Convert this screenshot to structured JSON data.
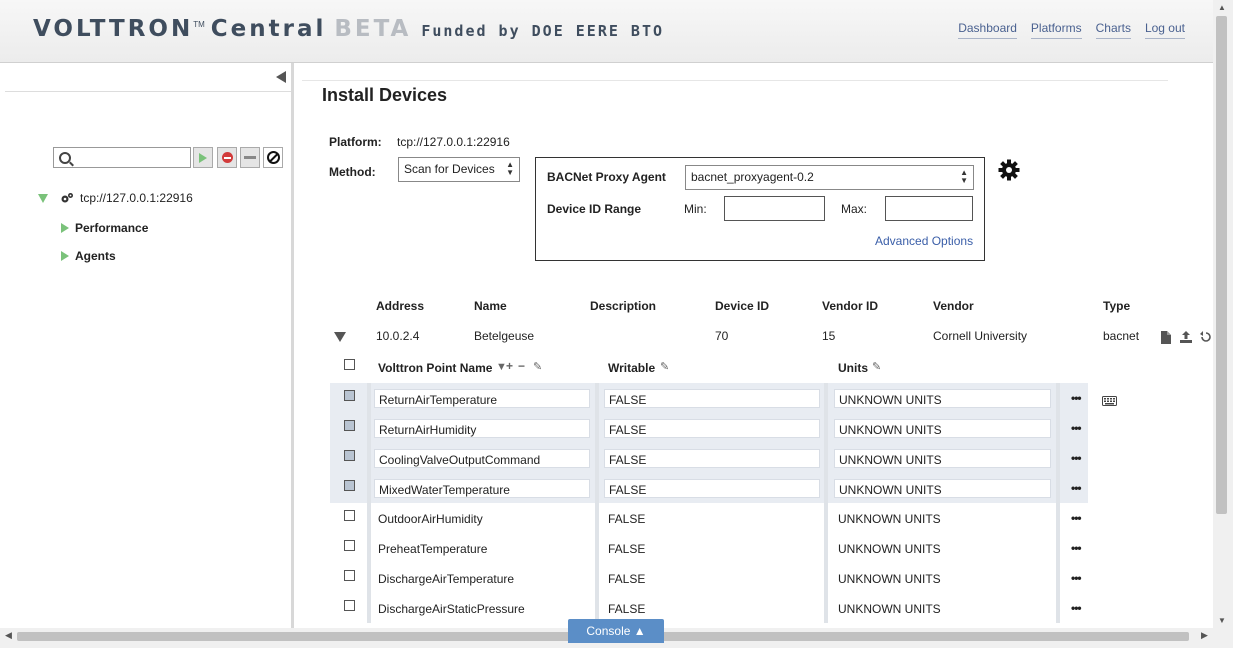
{
  "header": {
    "brand": "VOLTTRON",
    "tm": "TM",
    "central": "Central",
    "beta": "BETA",
    "funded": "Funded by DOE EERE BTO",
    "nav": [
      "Dashboard",
      "Platforms",
      "Charts",
      "Log out"
    ]
  },
  "sidebar": {
    "search_placeholder": "",
    "platform": "tcp://127.0.0.1:22916",
    "items": [
      "Performance",
      "Agents"
    ]
  },
  "main": {
    "title": "Install Devices",
    "platform_label": "Platform:",
    "platform_value": "tcp://127.0.0.1:22916",
    "method_label": "Method:",
    "method_value": "Scan for Devices",
    "proxy_label": "BACNet Proxy Agent",
    "proxy_value": "bacnet_proxyagent-0.2",
    "range_label": "Device ID Range",
    "min_label": "Min:",
    "max_label": "Max:",
    "min_value": "",
    "max_value": "",
    "advanced": "Advanced Options"
  },
  "devices": {
    "headers": [
      "Address",
      "Name",
      "Description",
      "Device ID",
      "Vendor ID",
      "Vendor",
      "Type"
    ],
    "row": {
      "address": "10.0.2.4",
      "name": "Betelgeuse",
      "description": "",
      "device_id": "70",
      "vendor_id": "15",
      "vendor": "Cornell University",
      "type": "bacnet"
    }
  },
  "points": {
    "headers": [
      "Volttron Point Name",
      "Writable",
      "Units"
    ],
    "rows": [
      {
        "name": "ReturnAirTemperature",
        "writable": "FALSE",
        "units": "UNKNOWN UNITS",
        "selected": true
      },
      {
        "name": "ReturnAirHumidity",
        "writable": "FALSE",
        "units": "UNKNOWN UNITS",
        "selected": true
      },
      {
        "name": "CoolingValveOutputCommand",
        "writable": "FALSE",
        "units": "UNKNOWN UNITS",
        "selected": true
      },
      {
        "name": "MixedWaterTemperature",
        "writable": "FALSE",
        "units": "UNKNOWN UNITS",
        "selected": true
      },
      {
        "name": "OutdoorAirHumidity",
        "writable": "FALSE",
        "units": "UNKNOWN UNITS",
        "selected": false
      },
      {
        "name": "PreheatTemperature",
        "writable": "FALSE",
        "units": "UNKNOWN UNITS",
        "selected": false
      },
      {
        "name": "DischargeAirTemperature",
        "writable": "FALSE",
        "units": "UNKNOWN UNITS",
        "selected": false
      },
      {
        "name": "DischargeAirStaticPressure",
        "writable": "FALSE",
        "units": "UNKNOWN UNITS",
        "selected": false
      }
    ]
  },
  "console": {
    "label": "Console ▲"
  },
  "colors": {
    "accent": "#5b8ec7",
    "link": "#4a6190",
    "tree_green": "#7ac27a"
  }
}
